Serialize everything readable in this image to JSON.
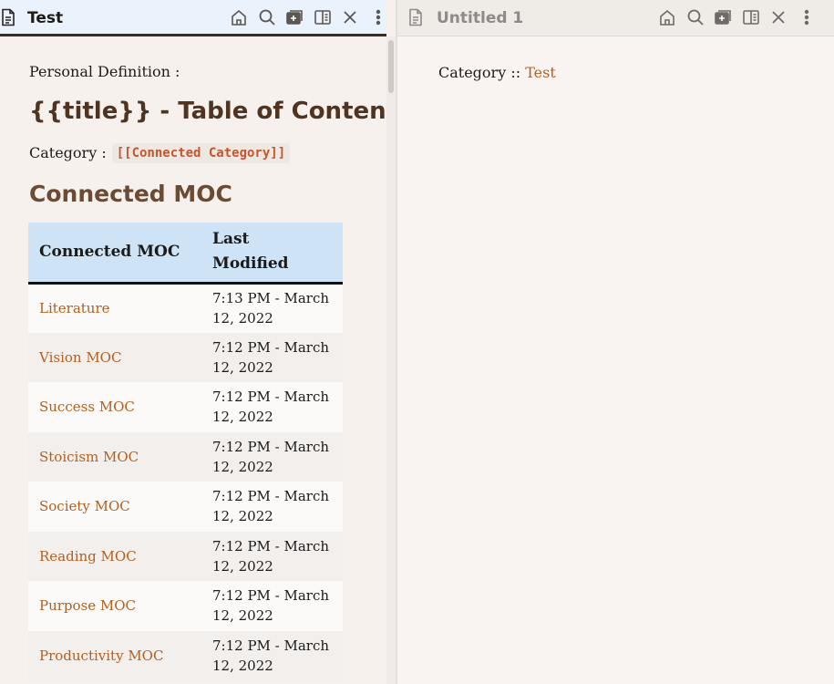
{
  "left_pane": {
    "tab_title": "Test",
    "personal_definition": "Personal Definition :",
    "doc_title": "{{title}} - Table of Content",
    "category_label": "Category :",
    "category_value": "[[Connected Category]]",
    "section_heading": "Connected MOC",
    "table": {
      "headers": [
        "Connected MOC",
        "Last Modified"
      ],
      "rows": [
        {
          "name": "Literature",
          "modified": "7:13 PM - March 12, 2022"
        },
        {
          "name": "Vision MOC",
          "modified": "7:12 PM - March 12, 2022"
        },
        {
          "name": "Success MOC",
          "modified": "7:12 PM - March 12, 2022"
        },
        {
          "name": "Stoicism MOC",
          "modified": "7:12 PM - March 12, 2022"
        },
        {
          "name": "Society MOC",
          "modified": "7:12 PM - March 12, 2022"
        },
        {
          "name": "Reading MOC",
          "modified": "7:12 PM - March 12, 2022"
        },
        {
          "name": "Purpose MOC",
          "modified": "7:12 PM - March 12, 2022"
        },
        {
          "name": "Productivity MOC",
          "modified": "7:12 PM - March 12, 2022"
        }
      ]
    }
  },
  "right_pane": {
    "tab_title": "Untitled 1",
    "category_label": "Category ::",
    "category_value": "Test"
  },
  "tab_actions": [
    "home-icon",
    "search-icon",
    "stack-add-icon",
    "sidebar-toggle-icon",
    "close-icon",
    "more-icon"
  ],
  "colors": {
    "link": "#b35f20",
    "code": "#c5562a",
    "heading": "#4e3421",
    "section_heading": "#6b4b34",
    "table_header_bg": "#cfe3f7",
    "active_tab_bg": "#eaf2fb"
  }
}
